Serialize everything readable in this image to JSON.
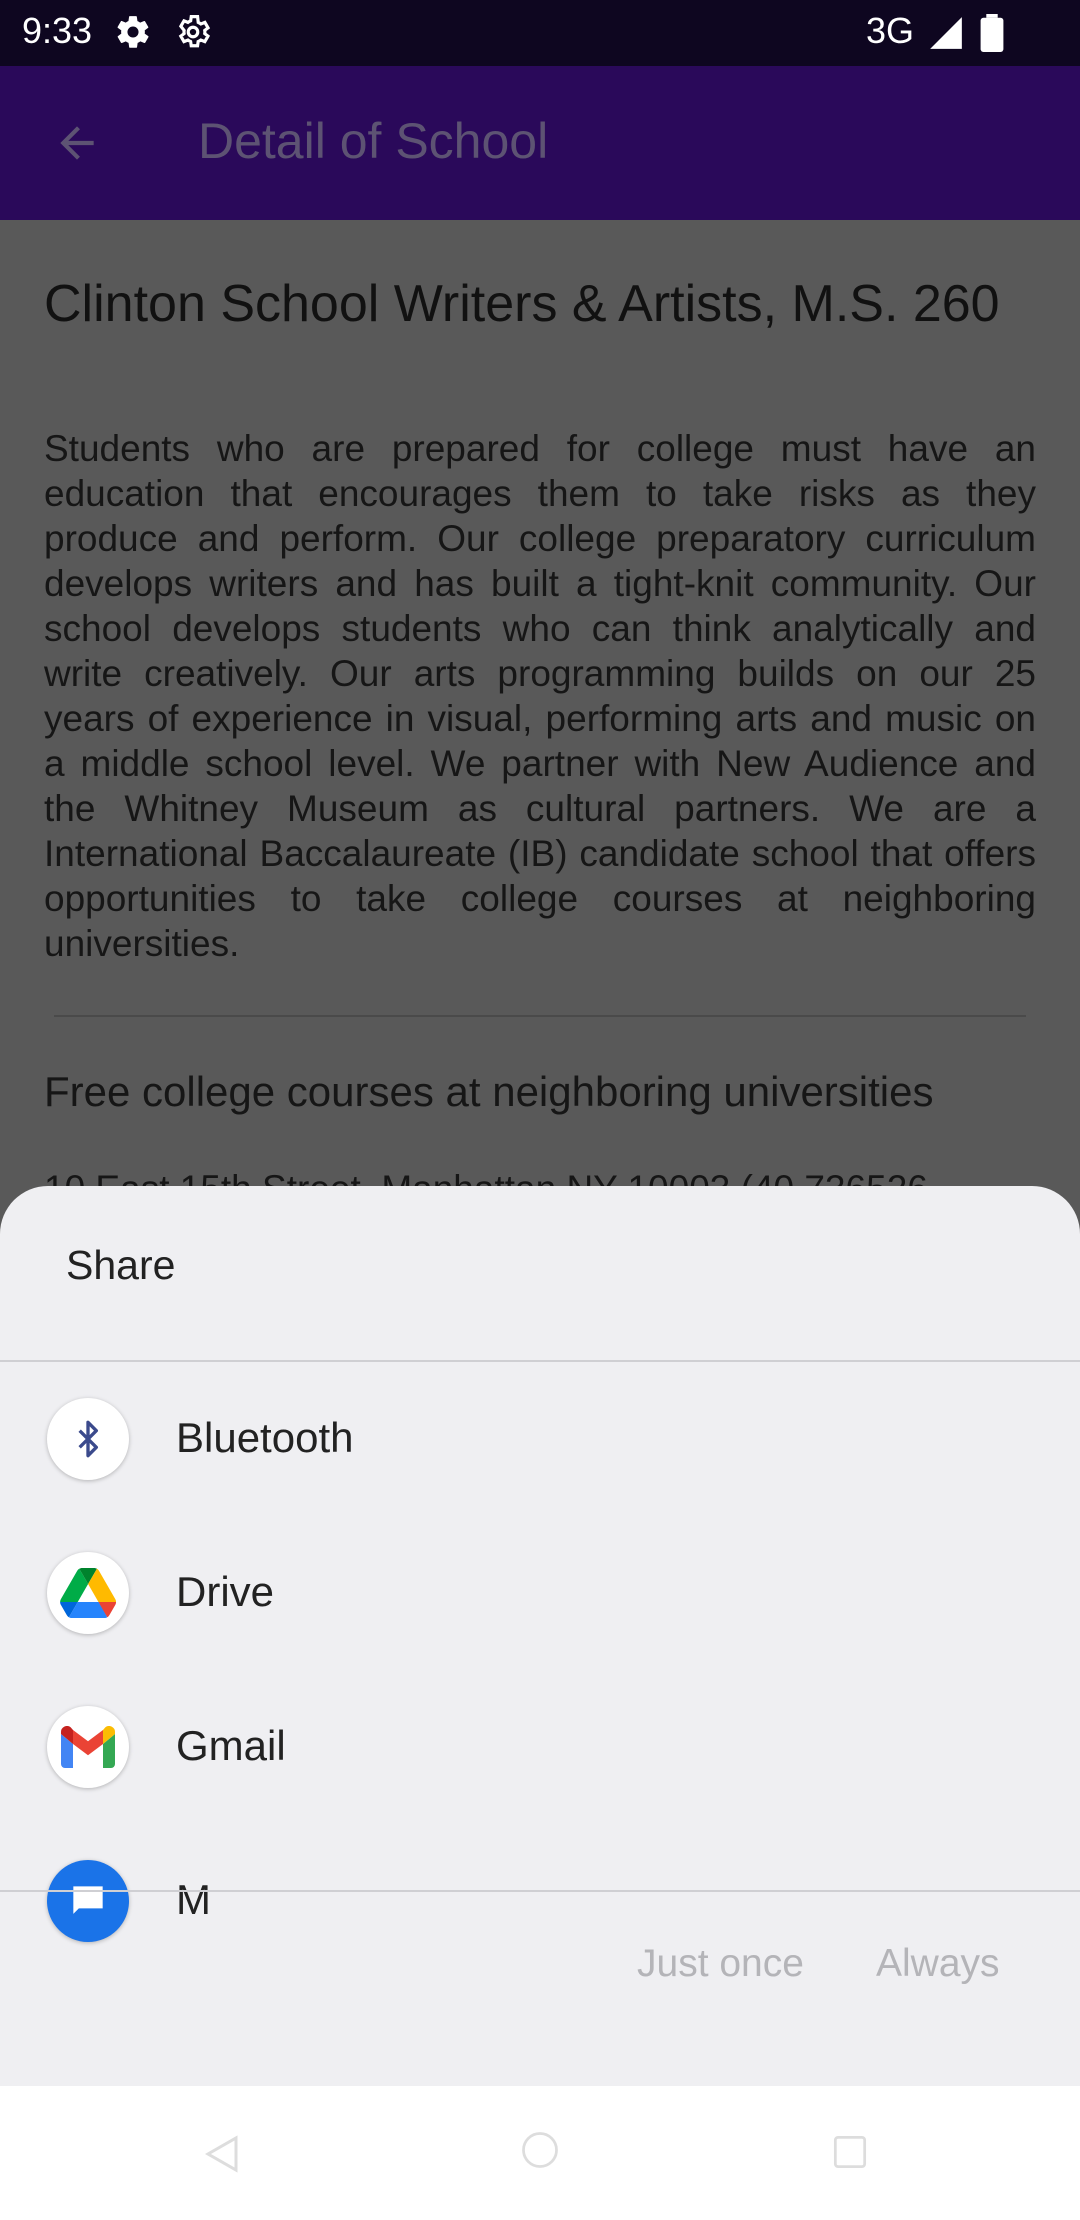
{
  "status_bar": {
    "time": "9:33",
    "network": "3G"
  },
  "app_bar": {
    "title": "Detail of School"
  },
  "school": {
    "name": "Clinton School Writers & Artists, M.S. 260",
    "description": "Students who are prepared for college must have an education that encourages them to take risks as they produce and perform. Our college preparatory curriculum develops writers and has built a tight-knit community. Our school develops students who can think analytically and write creatively. Our arts programming builds on our 25 years of experience in visual, performing arts and music on a middle school level. We partner with New Audience and the Whitney Museum as cultural partners. We are a International Baccalaureate (IB) candidate school that offers opportunities to take college courses at neighboring universities.",
    "highlight": "Free college courses at neighboring universities",
    "address": "10 East 15th Street, Manhattan NY 10003 (40.736526"
  },
  "share_sheet": {
    "title": "Share",
    "apps": [
      {
        "label": "Bluetooth",
        "icon": "bluetooth-icon"
      },
      {
        "label": "Drive",
        "icon": "google-drive-icon"
      },
      {
        "label": "Gmail",
        "icon": "gmail-icon"
      },
      {
        "label": "M",
        "icon": "messages-icon"
      }
    ],
    "just_once_label": "Just once",
    "always_label": "Always"
  },
  "colors": {
    "status_bar": "#0e0620",
    "app_bar": "#2a095a",
    "scrim_content": "#595959",
    "sheet_bg": "#efeff2",
    "disabled_button": "#b4b4b8"
  }
}
